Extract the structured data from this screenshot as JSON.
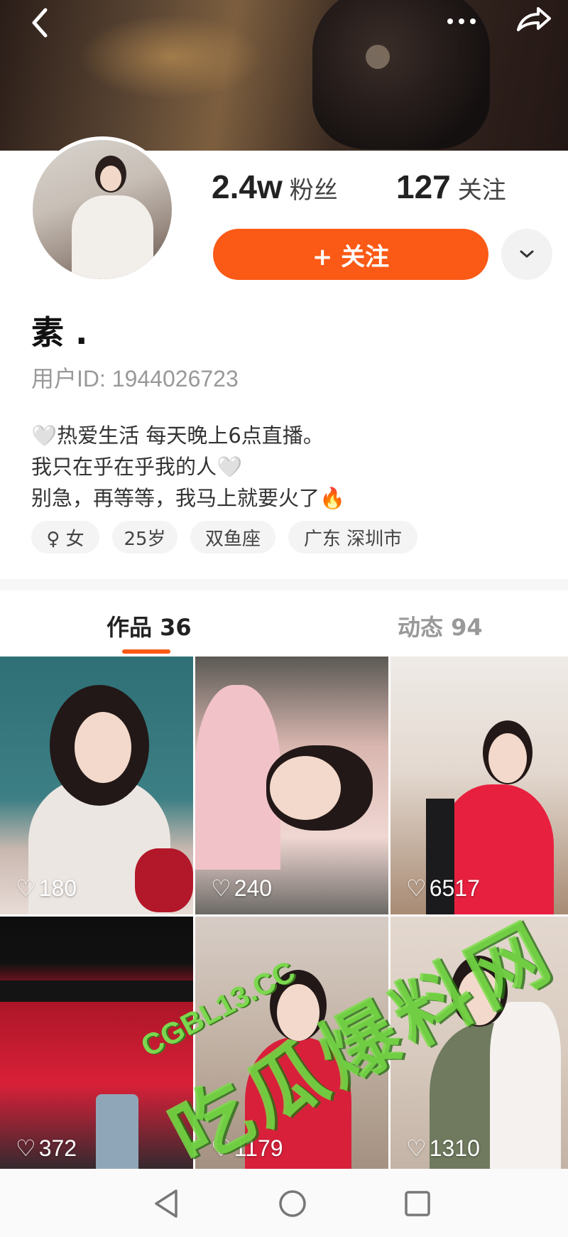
{
  "profile": {
    "followers_count": "2.4w",
    "followers_label": "粉丝",
    "following_count": "127",
    "following_label": "关注",
    "follow_button": "+ 关注",
    "name": "素 .",
    "user_id": "用户ID: 1944026723",
    "bio": [
      "🤍热爱生活 每天晚上6点直播。",
      "我只在乎在乎我的人🤍",
      "别急，再等等，我马上就要火了🔥"
    ],
    "tags": [
      "♀ 女",
      "25岁",
      "双鱼座",
      "广东 深圳市"
    ]
  },
  "tabs": [
    {
      "label": "作品 36",
      "active": true
    },
    {
      "label": "动态 94",
      "active": false
    }
  ],
  "posts": [
    {
      "likes": "180"
    },
    {
      "likes": "240"
    },
    {
      "likes": "6517"
    },
    {
      "likes": "372"
    },
    {
      "likes": "1179"
    },
    {
      "likes": "1310"
    }
  ],
  "watermark": {
    "url": "CGBL13.CC",
    "text": "吃瓜爆料网"
  },
  "icons": {
    "back": "chevron-left-icon",
    "more": "more-dots-icon",
    "share": "share-icon",
    "dropdown": "chevron-down-icon",
    "like": "heart-outline-icon",
    "nav_back": "triangle-back-icon",
    "nav_home": "circle-home-icon",
    "nav_recent": "square-recent-icon"
  },
  "colors": {
    "accent": "#fa5a16"
  }
}
